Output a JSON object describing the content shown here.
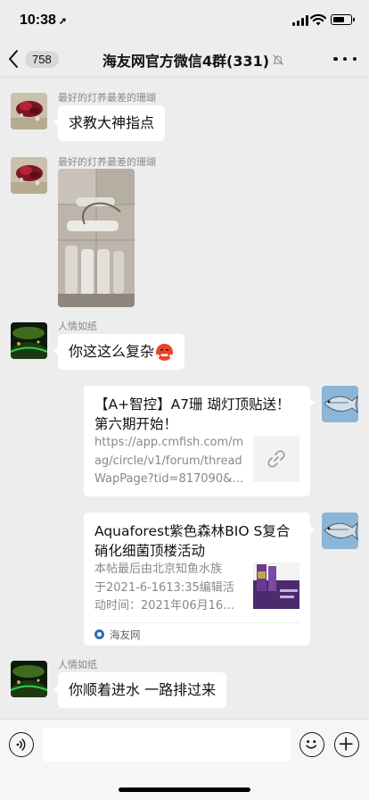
{
  "status_bar": {
    "time": "10:38",
    "location_glyph": "➚",
    "battery_level": 0.7
  },
  "nav": {
    "unread_count": "758",
    "title": "海友网官方微信4群(331)",
    "mute_icon": "bell-slash-icon",
    "more_icon": "ellipsis-icon",
    "back_icon": "chevron-left-icon"
  },
  "messages": [
    {
      "sender": "最好的灯养最差的珊瑚",
      "type": "text",
      "text": "求教大神指点"
    },
    {
      "sender": "最好的灯养最差的珊瑚",
      "type": "image"
    },
    {
      "sender": "人情如纸",
      "type": "text",
      "text": "你这这么复杂",
      "emoji": "face-with-steam-icon"
    },
    {
      "type": "link",
      "title": "【A+智控】A7珊 瑚灯顶贴送！第六期开始！",
      "desc_lines": [
        "https://app.cmfish.com/m",
        "ag/circle/v1/forum/thread",
        "WapPage?tid=817090&…"
      ],
      "thumb_icon": "link-icon"
    },
    {
      "type": "link",
      "title": "Aquaforest紫色森林BIO S复合硝化细菌顶楼活动",
      "desc_lines": [
        "本帖最后由北京知鱼水族",
        "于2021-6-1613:35编辑活",
        "动时间：2021年06月16…"
      ],
      "source": "海友网"
    },
    {
      "sender": "人情如纸",
      "type": "text",
      "text": "你顺着进水 一路排过来"
    }
  ],
  "input_bar": {
    "voice_icon": "voice-icon",
    "emoji_icon": "smiley-icon",
    "plus_icon": "plus-icon",
    "placeholder": ""
  },
  "colors": {
    "background": "#ededed",
    "bubble": "#ffffff",
    "sender_name": "#888888",
    "emoji_red": "#e8462b"
  }
}
